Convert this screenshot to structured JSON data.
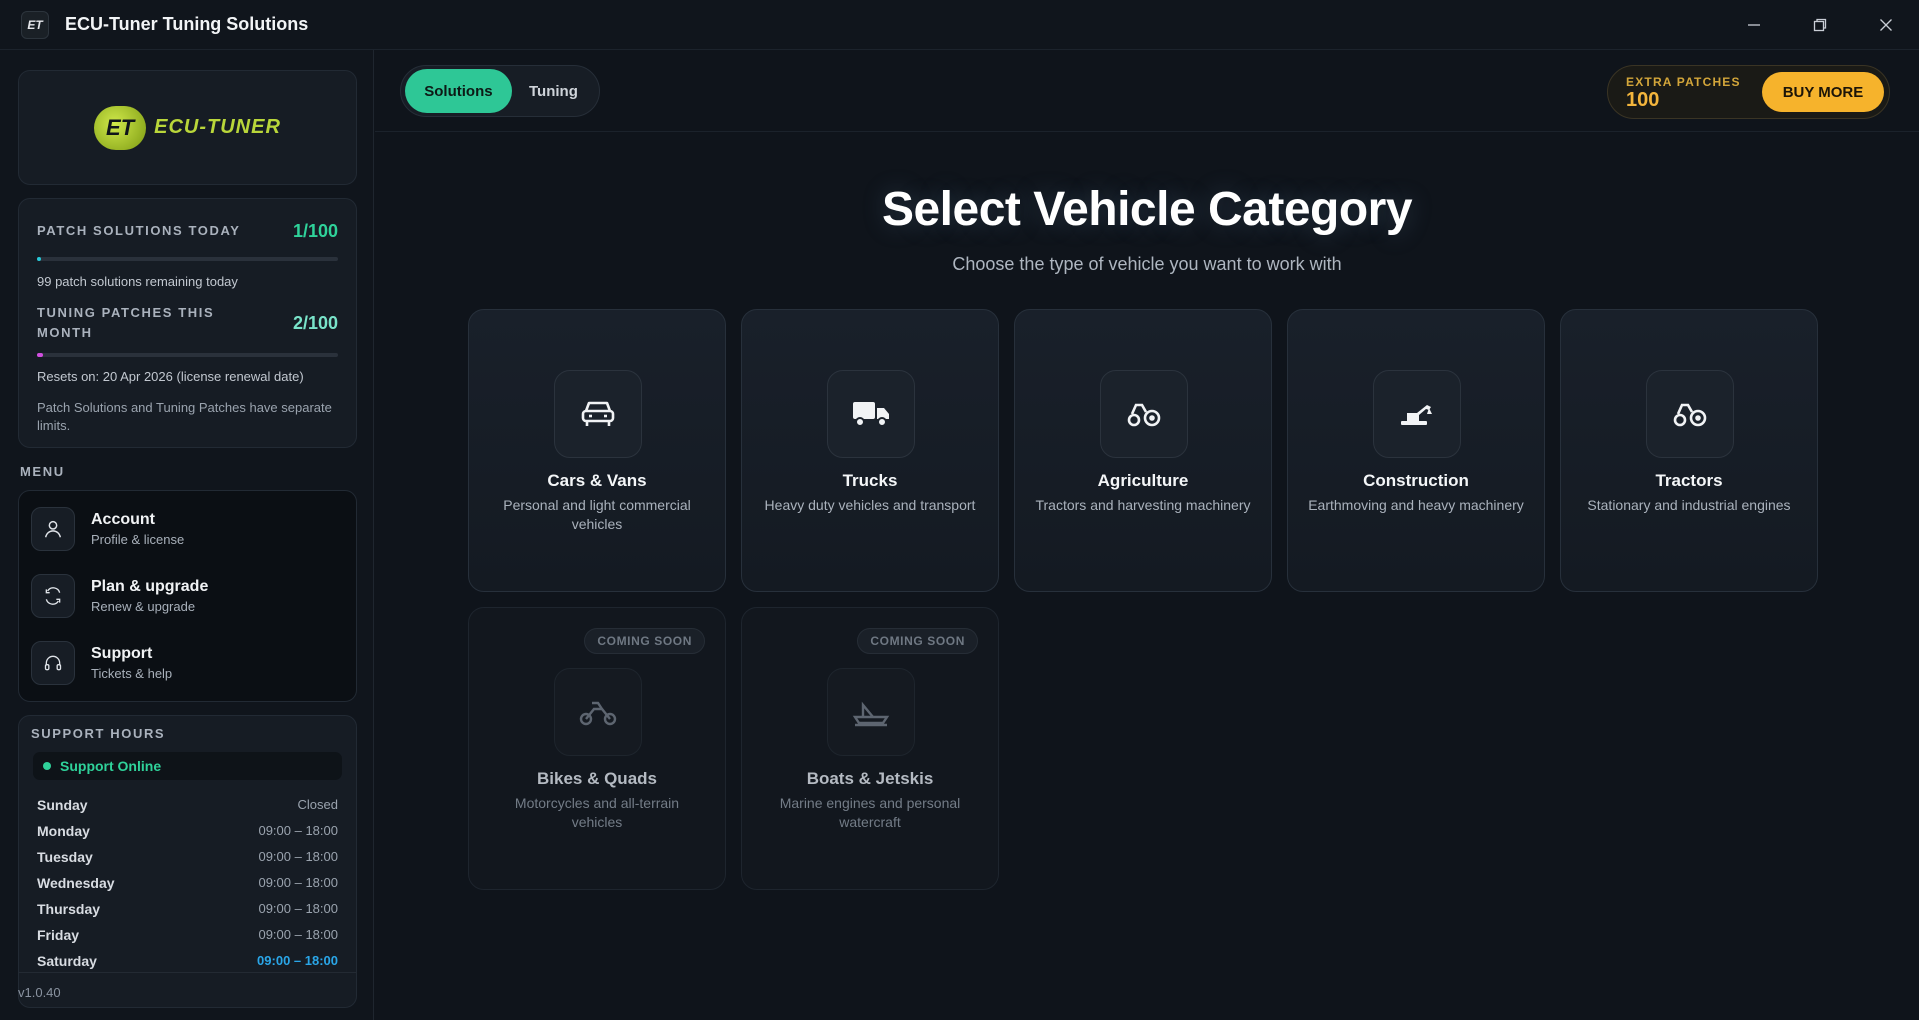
{
  "window": {
    "title": "ECU-Tuner Tuning Solutions",
    "icon_text": "ET"
  },
  "sidebar": {
    "logo": {
      "mark": "ET",
      "text": "ECU-TUNER"
    },
    "usage": {
      "patch_label": "PATCH SOLUTIONS TODAY",
      "patch_value": "1/100",
      "patch_progress": 0.01,
      "patch_note": "99 patch solutions remaining today",
      "tuning_label": "TUNING PATCHES THIS MONTH",
      "tuning_value": "2/100",
      "tuning_progress": 0.02,
      "reset_note": "Resets on: 20 Apr 2026 (license renewal date)",
      "limits_note": "Patch Solutions and Tuning Patches have separate limits."
    },
    "menu_heading": "MENU",
    "menu": [
      {
        "title": "Account",
        "sub": "Profile & license",
        "icon": "user-icon"
      },
      {
        "title": "Plan & upgrade",
        "sub": "Renew & upgrade",
        "icon": "refresh-icon"
      },
      {
        "title": "Support",
        "sub": "Tickets & help",
        "icon": "headset-icon"
      }
    ],
    "support": {
      "heading": "SUPPORT HOURS",
      "status": "Support Online",
      "status_color": "#2fd29a",
      "hours": [
        {
          "day": "Sunday",
          "time": "Closed"
        },
        {
          "day": "Monday",
          "time": "09:00 – 18:00"
        },
        {
          "day": "Tuesday",
          "time": "09:00 – 18:00"
        },
        {
          "day": "Wednesday",
          "time": "09:00 – 18:00"
        },
        {
          "day": "Thursday",
          "time": "09:00 – 18:00"
        },
        {
          "day": "Friday",
          "time": "09:00 – 18:00"
        },
        {
          "day": "Saturday",
          "time": "09:00 – 18:00"
        }
      ]
    },
    "version": "v1.0.40"
  },
  "topbar": {
    "tabs": [
      {
        "label": "Solutions",
        "active": true
      },
      {
        "label": "Tuning",
        "active": false
      }
    ],
    "extra_label": "EXTRA PATCHES",
    "extra_count": "100",
    "buy_label": "BUY MORE"
  },
  "main": {
    "title": "Select Vehicle Category",
    "subtitle": "Choose the type of vehicle you want to work with",
    "coming_soon": "COMING SOON",
    "categories": [
      {
        "title": "Cars & Vans",
        "desc": "Personal and light commercial vehicles",
        "icon": "car-icon",
        "enabled": true
      },
      {
        "title": "Trucks",
        "desc": "Heavy duty vehicles and transport",
        "icon": "truck-icon",
        "enabled": true
      },
      {
        "title": "Agriculture",
        "desc": "Tractors and harvesting machinery",
        "icon": "tractor-icon",
        "enabled": true
      },
      {
        "title": "Construction",
        "desc": "Earthmoving and heavy machinery",
        "icon": "excavator-icon",
        "enabled": true
      },
      {
        "title": "Tractors",
        "desc": "Stationary and industrial engines",
        "icon": "tractor-icon",
        "enabled": true
      },
      {
        "title": "Bikes & Quads",
        "desc": "Motorcycles and all-terrain vehicles",
        "icon": "motorbike-icon",
        "enabled": false
      },
      {
        "title": "Boats & Jetskis",
        "desc": "Marine engines and personal watercraft",
        "icon": "boat-icon",
        "enabled": false
      }
    ]
  }
}
